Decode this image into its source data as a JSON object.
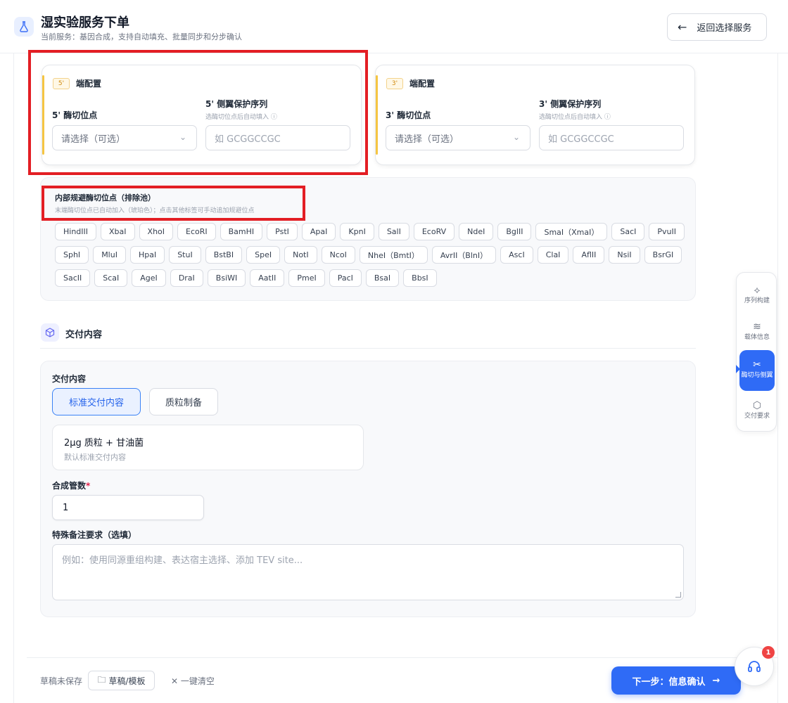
{
  "header": {
    "title": "湿实验服务下单",
    "subtitle": "当前服务：基因合成，支持自动填充、批量同步和分步确认",
    "back_label": "返回选择服务"
  },
  "five_prime": {
    "badge": "5'",
    "title": "端配置",
    "site_label": "5' 酶切位点",
    "site_placeholder": "请选择（可选）",
    "protect_label": "5' 侧翼保护序列",
    "protect_hint": "选酶切位点后自动填入",
    "protect_placeholder": "如 GCGGCCGC"
  },
  "three_prime": {
    "badge": "3'",
    "title": "端配置",
    "site_label": "3' 酶切位点",
    "site_placeholder": "请选择（可选）",
    "protect_label": "3' 侧翼保护序列",
    "protect_hint": "选酶切位点后自动填入",
    "protect_placeholder": "如 GCGGCCGC"
  },
  "avoid": {
    "title": "内部规避酶切位点（排除池）",
    "hint": "末端酶切位点已自动加入（琥珀色）；点击其他标签可手动追加规避位点",
    "enzymes": [
      "HindIII",
      "XbaI",
      "XhoI",
      "EcoRI",
      "BamHI",
      "PstI",
      "ApaI",
      "KpnI",
      "SalI",
      "EcoRV",
      "NdeI",
      "BglII",
      "SmaI（XmaI）",
      "SacI",
      "PvuII",
      "SphI",
      "MluI",
      "HpaI",
      "StuI",
      "BstBI",
      "SpeI",
      "NotI",
      "NcoI",
      "NheI（BmtI）",
      "AvrII（BlnI）",
      "AscI",
      "ClaI",
      "AflII",
      "NsiI",
      "BsrGI",
      "SacII",
      "ScaI",
      "AgeI",
      "DraI",
      "BsiWI",
      "AatII",
      "PmeI",
      "PacI",
      "BsaI",
      "BbsI"
    ]
  },
  "delivery": {
    "section_title": "交付内容",
    "content_label": "交付内容",
    "options": [
      "标准交付内容",
      "质粒制备"
    ],
    "info_main": "2μg 质粒 + 甘油菌",
    "info_sub": "默认标准交付内容",
    "tubes_label": "合成管数",
    "tubes_required": "*",
    "tubes_value": "1",
    "remark_label": "特殊备注要求（选填）",
    "remark_placeholder": "例如：使用同源重组构建、表达宿主选择、添加 TEV site..."
  },
  "side_nav": {
    "items": [
      "序列构建",
      "载体信息",
      "酶切与侧翼",
      "交付要求"
    ],
    "active_index": 2
  },
  "footer": {
    "draft_status": "草稿未保存",
    "draft_button": "草稿/模板",
    "clear_button": "一键清空",
    "next_button": "下一步：信息确认"
  },
  "support": {
    "badge": "1"
  },
  "colors": {
    "accent": "#2f6bf6",
    "amber": "#f5c542",
    "highlight_box": "#e31e24"
  }
}
